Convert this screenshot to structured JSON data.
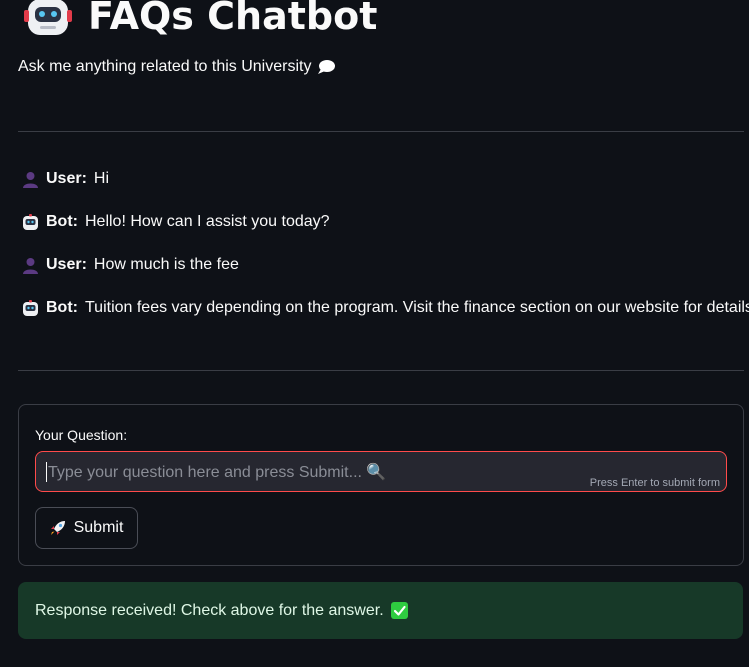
{
  "header": {
    "title": "FAQs Chatbot",
    "subtitle": "Ask me anything related to this University",
    "icons": [
      "robot-icon",
      "speech-bubble-icon"
    ]
  },
  "chat": {
    "messages": [
      {
        "role": "user",
        "who": "User:",
        "text": "Hi",
        "icon": "user-silhouette-icon"
      },
      {
        "role": "bot",
        "who": "Bot:",
        "text": "Hello! How can I assist you today?",
        "icon": "robot-icon"
      },
      {
        "role": "user",
        "who": "User:",
        "text": "How much is the fee",
        "icon": "user-silhouette-icon"
      },
      {
        "role": "bot",
        "who": "Bot:",
        "text": "Tuition fees vary depending on the program. Visit the finance section on our website for details.",
        "icon": "robot-icon"
      }
    ]
  },
  "form": {
    "label": "Your Question:",
    "input_value": "",
    "placeholder": "Type your question here and press Submit... 🔍",
    "hint": "Press Enter to submit form",
    "submit_label": "Submit",
    "submit_icon": "rocket-icon"
  },
  "status": {
    "message": "Response received! Check above for the answer.",
    "icon": "check-mark-icon"
  },
  "colors": {
    "background": "#0e1117",
    "input_background": "#262730",
    "input_border_focus": "#ff4b4b",
    "success_background": "#173928",
    "text": "#fafafa"
  }
}
